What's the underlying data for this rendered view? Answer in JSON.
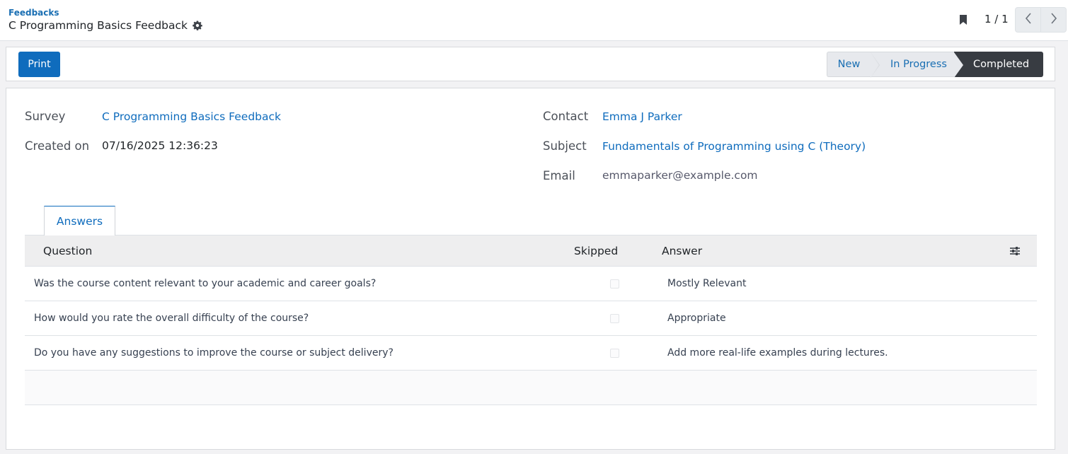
{
  "header": {
    "breadcrumb": "Feedbacks",
    "title": "C Programming Basics Feedback",
    "pager_value": "1 / 1"
  },
  "statusbar": {
    "print_label": "Print",
    "stages": [
      "New",
      "In Progress",
      "Completed"
    ],
    "current_stage": "Completed"
  },
  "fields": {
    "survey_label": "Survey",
    "survey_value": "C Programming Basics Feedback",
    "created_label": "Created on",
    "created_value": "07/16/2025 12:36:23",
    "contact_label": "Contact",
    "contact_value": "Emma J Parker",
    "subject_label": "Subject",
    "subject_value": "Fundamentals of Programming using C (Theory)",
    "email_label": "Email",
    "email_value": "emmaparker@example.com"
  },
  "tabs": [
    {
      "label": "Answers"
    }
  ],
  "table": {
    "headers": {
      "question": "Question",
      "skipped": "Skipped",
      "answer": "Answer"
    },
    "rows": [
      {
        "question": "Was the course content relevant to your academic and career goals?",
        "skipped": false,
        "answer": "Mostly Relevant"
      },
      {
        "question": "How would you rate the overall difficulty of the course?",
        "skipped": false,
        "answer": "Appropriate"
      },
      {
        "question": "Do you have any suggestions to improve the course or subject delivery?",
        "skipped": false,
        "answer": "Add more real-life examples during lectures."
      }
    ]
  },
  "colors": {
    "accent": "#0f6cbd",
    "stage_active_bg": "#383c42",
    "stage_inactive_bg": "#e7e9ed"
  },
  "icons": {
    "title_action": "gear-icon",
    "favorite": "bookmark-icon",
    "pager_prev": "chevron-left-icon",
    "pager_next": "chevron-right-icon",
    "column_options": "sliders-icon"
  }
}
